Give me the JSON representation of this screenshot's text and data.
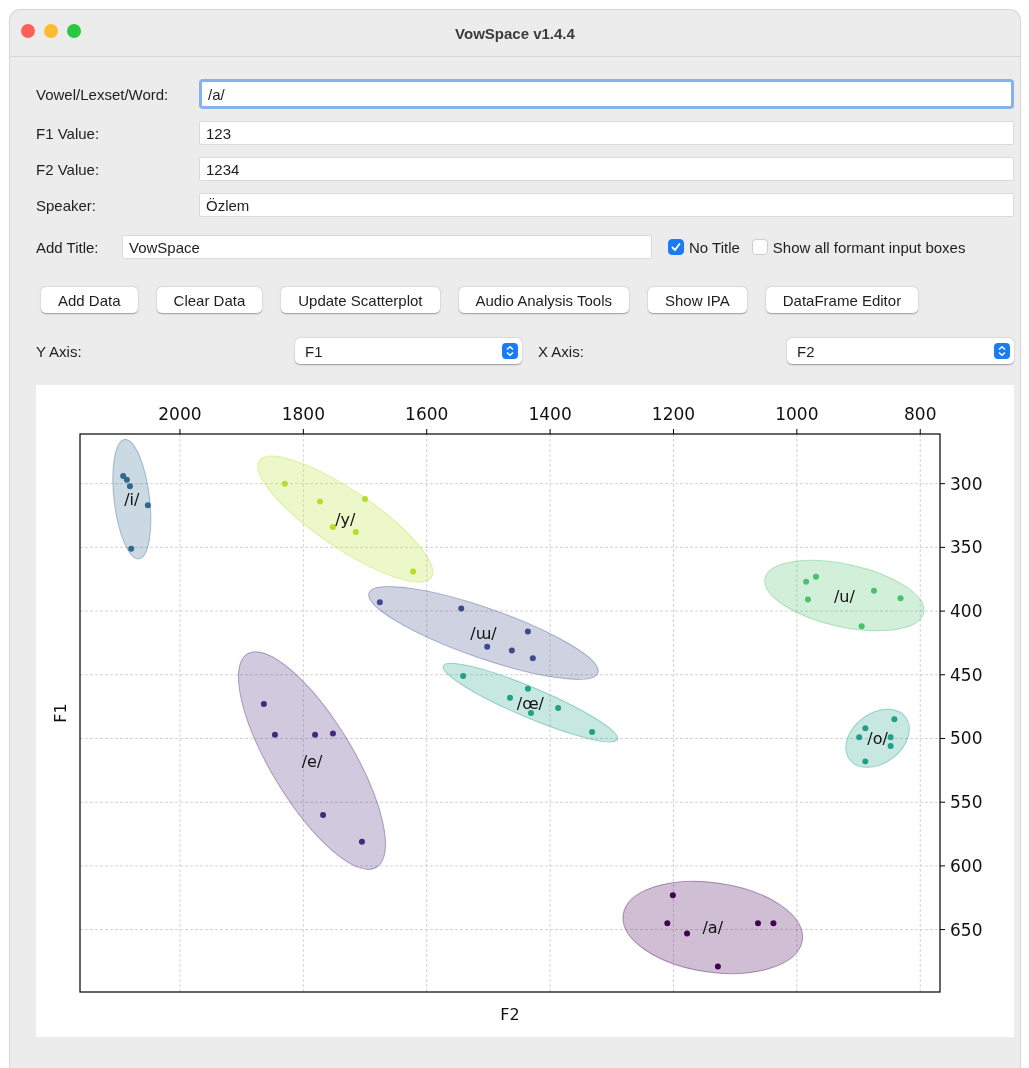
{
  "window": {
    "title": "VowSpace v1.4.4"
  },
  "fields": [
    {
      "label": "Vowel/Lexset/Word:",
      "value": "/a/",
      "focused": true
    },
    {
      "label": "F1 Value:",
      "value": "123",
      "focused": false
    },
    {
      "label": "F2 Value:",
      "value": "1234",
      "focused": false
    },
    {
      "label": "Speaker:",
      "value": "Özlem",
      "focused": false
    }
  ],
  "title_row": {
    "label": "Add Title:",
    "value": "VowSpace",
    "options": [
      {
        "label": "No Title",
        "checked": true
      },
      {
        "label": "Show all formant input boxes",
        "checked": false
      }
    ]
  },
  "buttons": [
    "Add Data",
    "Clear Data",
    "Update Scatterplot",
    "Audio Analysis Tools",
    "Show IPA",
    "DataFrame Editor"
  ],
  "axes": [
    {
      "label": "Y Axis:",
      "value": "F1"
    },
    {
      "label": "X Axis:",
      "value": "F2"
    }
  ],
  "plot": {
    "chart_data": {
      "type": "scatter",
      "grid": true,
      "xlabel": "F2",
      "ylabel": "F1",
      "xlim": [
        2162,
        768
      ],
      "ylim": [
        699,
        261
      ],
      "xticks": [
        2000,
        1800,
        1600,
        1400,
        1200,
        1000,
        800
      ],
      "yticks": [
        300,
        350,
        400,
        450,
        500,
        550,
        600,
        650
      ],
      "series": [
        {
          "name": "/i/",
          "color": "#31688e",
          "x": [
            2092,
            2086,
            2081,
            2052,
            2079
          ],
          "values": [
            294,
            297,
            302,
            317,
            351
          ]
        },
        {
          "name": "/y/",
          "color": "#b5de2b",
          "x": [
            1830,
            1773,
            1752,
            1700,
            1715,
            1622
          ],
          "values": [
            300,
            314,
            334,
            312,
            338,
            369
          ]
        },
        {
          "name": "/ɯ/",
          "color": "#3e4a89",
          "x": [
            1676,
            1544,
            1436,
            1502,
            1462,
            1428
          ],
          "values": [
            393,
            398,
            416,
            428,
            431,
            437
          ]
        },
        {
          "name": "/œ/",
          "color": "#1fa187",
          "x": [
            1541,
            1465,
            1436,
            1431,
            1387,
            1332
          ],
          "values": [
            451,
            468,
            461,
            480,
            476,
            495
          ]
        },
        {
          "name": "/u/",
          "color": "#4ac16d",
          "x": [
            985,
            969,
            982,
            875,
            832,
            895
          ],
          "values": [
            377,
            373,
            391,
            384,
            390,
            412
          ]
        },
        {
          "name": "/o/",
          "color": "#1f9e89",
          "x": [
            899,
            889,
            842,
            848,
            848,
            889
          ],
          "values": [
            499,
            492,
            485,
            499,
            506,
            518
          ]
        },
        {
          "name": "/e/",
          "color": "#482878",
          "x": [
            1864,
            1846,
            1781,
            1752,
            1768,
            1705
          ],
          "values": [
            473,
            497,
            497,
            496,
            560,
            581
          ]
        },
        {
          "name": "/a/",
          "color": "#440154",
          "x": [
            1201,
            1210,
            1178,
            1128,
            1063,
            1038
          ],
          "values": [
            623,
            645,
            653,
            679,
            645,
            645
          ]
        }
      ]
    }
  }
}
